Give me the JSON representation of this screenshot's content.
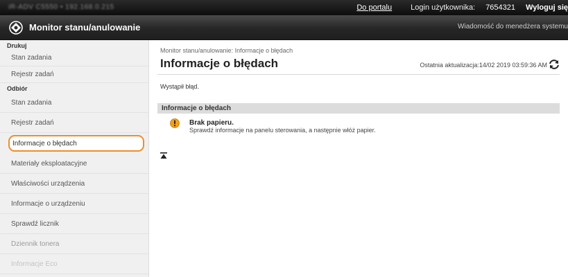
{
  "topbar": {
    "device_name": "iR-ADV C5550  •  192.168.0.215",
    "portal_link": "Do portalu",
    "login_label": "Login użytkownika:",
    "user_id": "7654321",
    "logout_link": "Wyloguj się"
  },
  "titlebar": {
    "title": "Monitor stanu/anulowanie",
    "message_link": "Wiadomość do menedżera systemu"
  },
  "sidebar": {
    "sections": [
      {
        "label": "Drukuj",
        "items": [
          "Stan zadania",
          "Rejestr zadań"
        ]
      },
      {
        "label": "Odbiór",
        "items": [
          "Stan zadania",
          "Rejestr zadań"
        ]
      }
    ],
    "items": [
      "Informacje o błędach",
      "Materiały eksploatacyjne",
      "Właściwości urządzenia",
      "Informacje o urządzeniu",
      "Sprawdź licznik",
      "Dziennik tonera",
      "Informacje Eco"
    ],
    "active_item": "Informacje o błędach"
  },
  "main": {
    "breadcrumb": "Monitor stanu/anulowanie: Informacje o błędach",
    "page_title": "Informacje o błędach",
    "last_update": "Ostatnia aktualizacja:14/02 2019 03:59:36 AM",
    "status_text": "Wystąpił błąd.",
    "section_header": "Informacje o błędach",
    "error": {
      "title": "Brak papieru.",
      "description": "Sprawdź informacje na panelu sterowania, a następnie włóż papier.",
      "icon": "warning-icon"
    }
  },
  "colors": {
    "active_border": "#ef8c2b",
    "warning": "#f0a01e",
    "header_dark": "#1f1f1f"
  }
}
